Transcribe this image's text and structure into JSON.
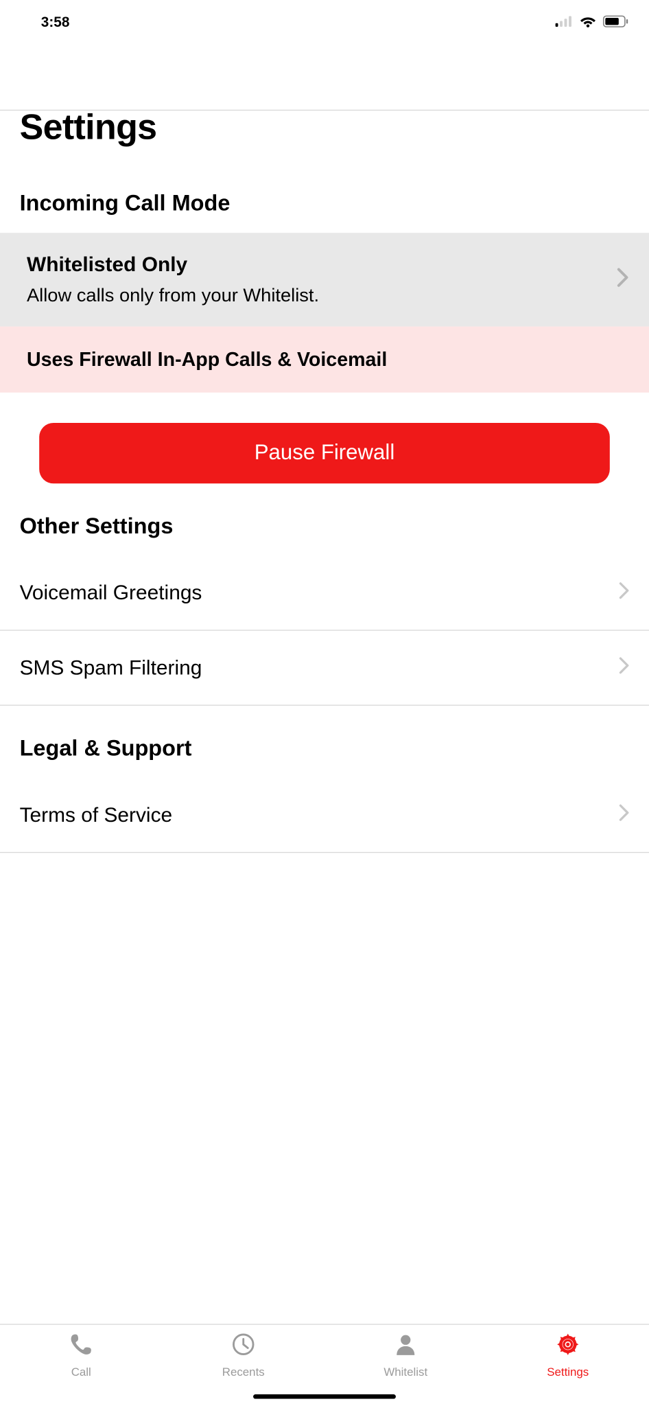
{
  "status": {
    "time": "3:58"
  },
  "page": {
    "title": "Settings"
  },
  "sections": {
    "incoming": {
      "header": "Incoming Call Mode",
      "mode_title": "Whitelisted Only",
      "mode_sub": "Allow calls only from your Whitelist.",
      "banner": "Uses Firewall In-App Calls & Voicemail",
      "pause_btn": "Pause Firewall"
    },
    "other": {
      "header": "Other Settings",
      "items": [
        {
          "label": "Voicemail Greetings"
        },
        {
          "label": "SMS Spam Filtering"
        }
      ]
    },
    "legal": {
      "header": "Legal & Support",
      "items": [
        {
          "label": "Terms of Service"
        }
      ]
    }
  },
  "tabs": [
    {
      "label": "Call",
      "icon": "phone-icon",
      "active": false
    },
    {
      "label": "Recents",
      "icon": "clock-icon",
      "active": false
    },
    {
      "label": "Whitelist",
      "icon": "person-icon",
      "active": false
    },
    {
      "label": "Settings",
      "icon": "gear-icon",
      "active": true
    }
  ]
}
